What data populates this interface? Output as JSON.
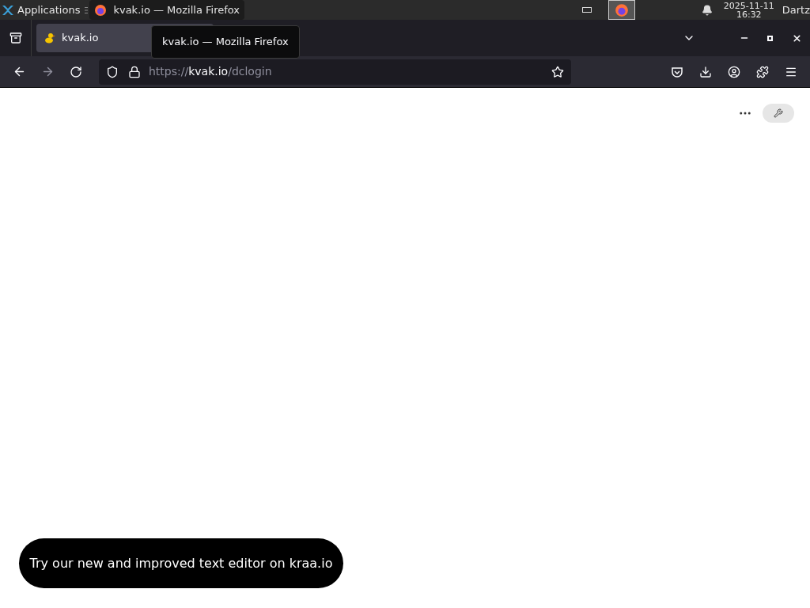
{
  "taskbar": {
    "apps_label": "Applications",
    "window_button": {
      "title": "kvak.io — Mozilla Firefox",
      "selected": true
    },
    "clock": {
      "date": "2025-11-11",
      "time": "16:32"
    },
    "user": "Dartz"
  },
  "browser": {
    "tabs": [
      {
        "title": "kvak.io",
        "selected": true
      }
    ],
    "tooltip": "kvak.io — Mozilla Firefox",
    "url": {
      "scheme": "https://",
      "host": "kvak.io",
      "path": "/dclogin"
    }
  },
  "page": {
    "banner": "Try our new and improved text editor on kraa.io"
  }
}
